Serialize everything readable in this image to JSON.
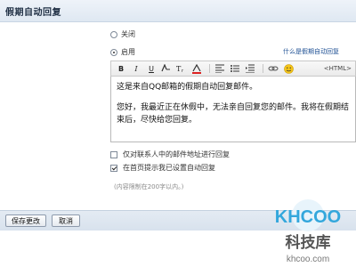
{
  "header": {
    "title": "假期自动回复"
  },
  "options": {
    "off_label": "关闭",
    "on_label": "启用",
    "selected": "on",
    "help_link": "什么是假期自动回复"
  },
  "toolbar": {
    "bold": "B",
    "italic": "I",
    "underline": "U",
    "font": "T",
    "html_label": "<HTML>",
    "icons": [
      "bold-icon",
      "italic-icon",
      "underline-icon",
      "font-icon",
      "font-size-icon",
      "font-color-icon",
      "align-icon",
      "list-icon",
      "indent-icon",
      "link-icon",
      "emoji-icon"
    ]
  },
  "editor": {
    "line1": "这是来自QQ邮箱的假期自动回复邮件。",
    "line2": "您好，我最近正在休假中，无法亲自回复您的邮件。我将在假期结束后，尽快给您回复。"
  },
  "settings": {
    "contacts_only_label": "仅对联系人中的邮件地址进行回复",
    "contacts_only_checked": false,
    "homepage_notice_label": "在首页提示我已设置自动回复",
    "homepage_notice_checked": true,
    "limit_hint": "(内容限制在200字以内。)"
  },
  "footer": {
    "save_label": "保存更改",
    "cancel_label": "取消"
  },
  "watermark": {
    "logo_text": "KHCOO",
    "cn_text": "科技库",
    "url_text": "khcoo.com"
  }
}
